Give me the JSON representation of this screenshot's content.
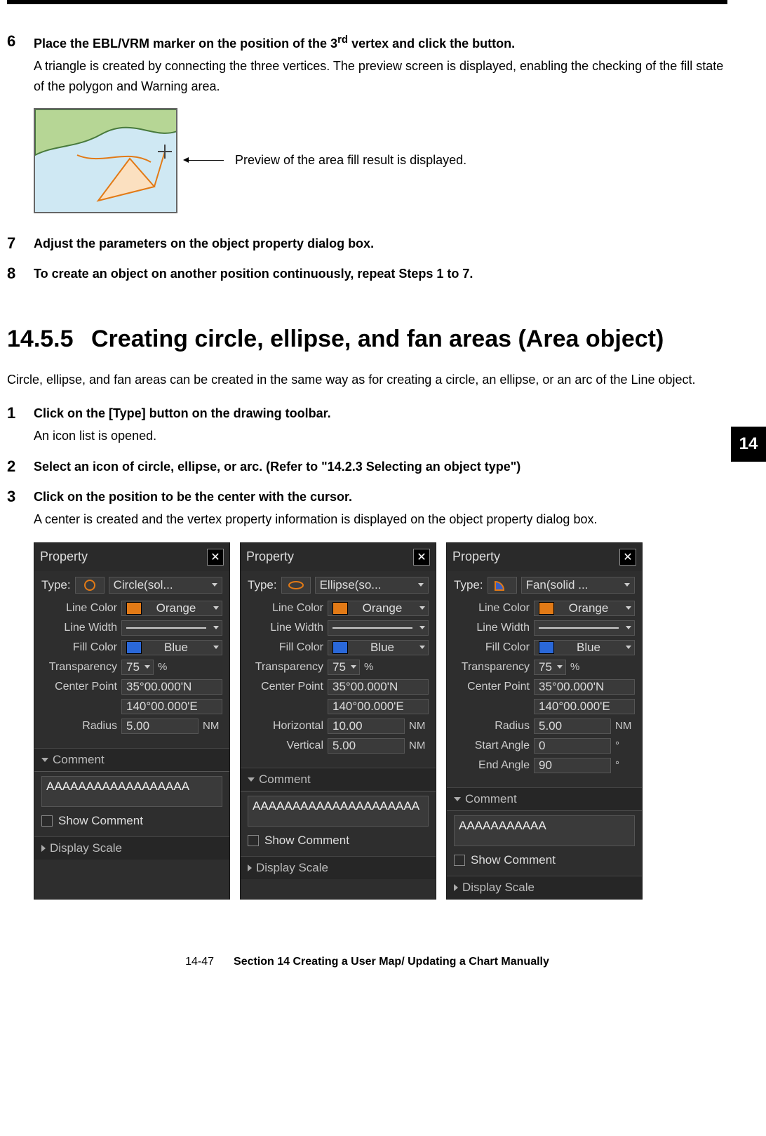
{
  "chapterTab": "14",
  "steps_a": [
    {
      "num": "6",
      "title_pre": "Place the EBL/VRM marker on the position of the 3",
      "title_sup": "rd",
      "title_post": " vertex and click the button.",
      "desc": "A triangle is created by connecting the three vertices. The preview screen is displayed, enabling the checking of the fill state of the polygon and Warning area."
    }
  ],
  "previewCaption": "Preview of the area fill result is displayed.",
  "steps_b": [
    {
      "num": "7",
      "title": "Adjust the parameters on the object property dialog box."
    },
    {
      "num": "8",
      "title": "To create an object on another position continuously, repeat Steps 1 to 7."
    }
  ],
  "section": {
    "num": "14.5.5",
    "title": "Creating circle, ellipse, and fan areas (Area object)",
    "intro": "Circle, ellipse, and fan areas can be created in the same way as for creating a circle, an ellipse, or an arc of the Line object."
  },
  "steps_c": [
    {
      "num": "1",
      "title": "Click on the [Type] button on the drawing toolbar.",
      "desc": "An icon list is opened."
    },
    {
      "num": "2",
      "title": "Select an icon of circle, ellipse, or arc. (Refer to \"14.2.3 Selecting an object type\")"
    },
    {
      "num": "3",
      "title": "Click on the position to be the center with the cursor.",
      "desc": "A center is created and the vertex property information is displayed on the object property dialog box."
    }
  ],
  "labels": {
    "property": "Property",
    "type": "Type:",
    "lineColor": "Line Color",
    "lineWidth": "Line Width",
    "fillColor": "Fill Color",
    "transparency": "Transparency",
    "centerPoint": "Center Point",
    "radius": "Radius",
    "horizontal": "Horizontal",
    "vertical": "Vertical",
    "startAngle": "Start Angle",
    "endAngle": "End Angle",
    "comment": "Comment",
    "showComment": "Show Comment",
    "displayScale": "Display Scale",
    "percent": "%",
    "nm": "NM",
    "deg": "°"
  },
  "values": {
    "orange": "Orange",
    "blue": "Blue",
    "transparency": "75",
    "lat": "35°00.000'N",
    "lon": "140°00.000'E",
    "radius": "5.00",
    "horizontal": "10.00",
    "vertical": "5.00",
    "startAngle": "0",
    "endAngle": "90"
  },
  "panels": [
    {
      "typeName": "Circle(sol... ",
      "shape": "circle",
      "extra": "radius",
      "commentText": "AAAAAAAAAAAAAAAAAA"
    },
    {
      "typeName": "Ellipse(so... ",
      "shape": "ellipse",
      "extra": "ellipse",
      "commentText": "AAAAAAAAAAAAAAAAAAAAA"
    },
    {
      "typeName": "Fan(solid ... ",
      "shape": "fan",
      "extra": "fan",
      "commentText": "AAAAAAAAAAA"
    }
  ],
  "footer": {
    "page": "14-47",
    "section": "Section 14    Creating a User Map/ Updating a Chart Manually"
  }
}
